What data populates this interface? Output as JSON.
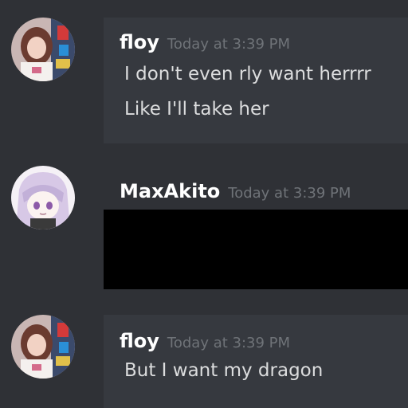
{
  "colors": {
    "background": "#2f3136",
    "message_bg": "#36393f",
    "username": "#ffffff",
    "timestamp": "#6f7378",
    "message_text": "#dcddde"
  },
  "messages": [
    {
      "username": "floy",
      "timestamp": "Today at 3:39 PM",
      "lines": [
        "I don't even rly want herrrr",
        "Like I'll take her"
      ]
    },
    {
      "username": "MaxAkito",
      "timestamp": "Today at 3:39 PM",
      "lines": []
    },
    {
      "username": "floy",
      "timestamp": "Today at 3:39 PM",
      "lines": [
        "But I want my dragon"
      ]
    }
  ]
}
